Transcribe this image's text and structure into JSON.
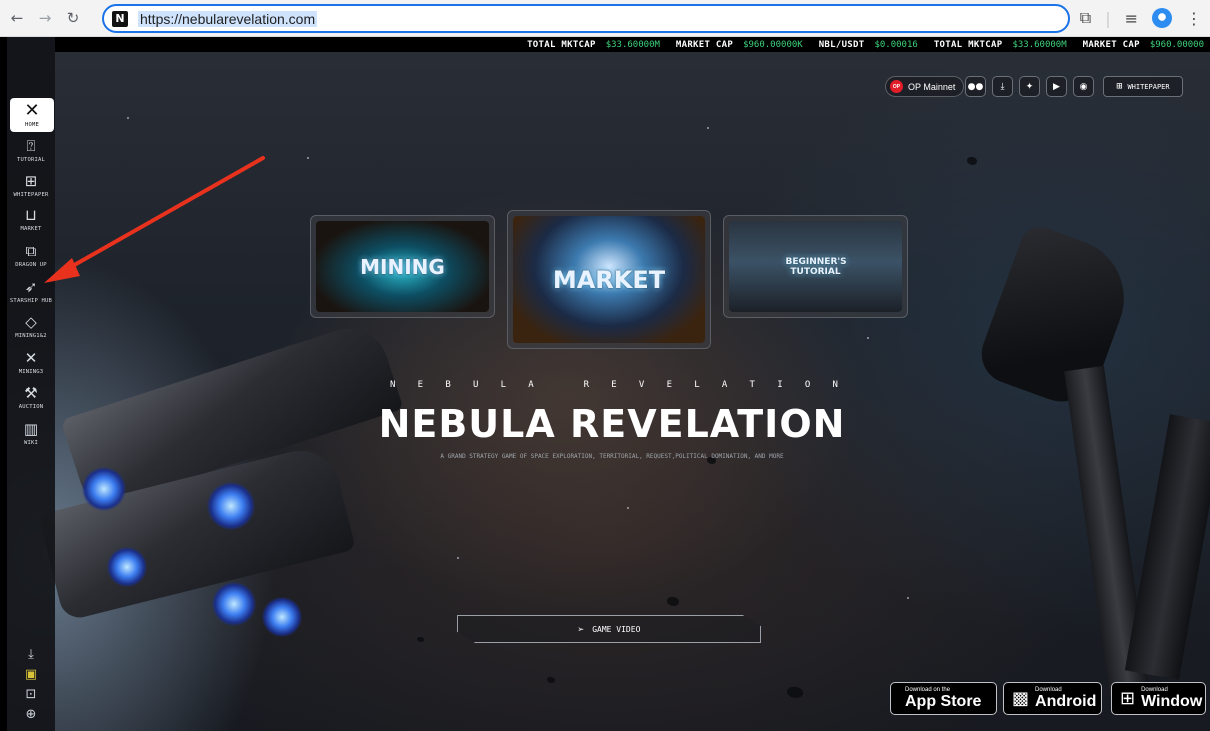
{
  "browser": {
    "url": "https://nebularevelation.com",
    "favicon": "N"
  },
  "ticker": [
    {
      "label": "TOTAL MKTCAP",
      "value": "$33.60000M"
    },
    {
      "label": "MARKET CAP",
      "value": "$960.00000K"
    },
    {
      "label": "NBL/USDT",
      "value": "$0.00016"
    },
    {
      "label": "TOTAL MKTCAP",
      "value": "$33.60000M"
    },
    {
      "label": "MARKET CAP",
      "value": "$960.00000"
    }
  ],
  "sidebar": {
    "items": [
      {
        "label": "HOME",
        "icon": "nebula-logo-icon"
      },
      {
        "label": "TUTORIAL",
        "icon": "question-icon"
      },
      {
        "label": "WHITEPAPER",
        "icon": "book-icon"
      },
      {
        "label": "MARKET",
        "icon": "shopping-bag-icon"
      },
      {
        "label": "DRAGON UP",
        "icon": "copy-icon"
      },
      {
        "label": "STARSHIP HUB",
        "icon": "rocket-icon"
      },
      {
        "label": "MINING1&2",
        "icon": "diamond-icon"
      },
      {
        "label": "MINING3",
        "icon": "crossed-tools-icon"
      },
      {
        "label": "AUCTION",
        "icon": "gavel-icon"
      },
      {
        "label": "WIKI",
        "icon": "library-icon"
      }
    ],
    "bottom_icons": [
      "download-icon",
      "wallet-icon",
      "profile-card-icon",
      "globe-icon"
    ]
  },
  "header": {
    "network": "OP Mainnet",
    "network_badge": "OP",
    "social_icons": [
      "medium-icon",
      "download-icon",
      "twitter-icon",
      "youtube-icon",
      "discord-icon"
    ],
    "whitepaper_label": "WHITEPAPER"
  },
  "cards": [
    {
      "title": "MINING"
    },
    {
      "title": "MARKET"
    },
    {
      "title": "BEGINNER'S TUTORIAL"
    }
  ],
  "hero": {
    "spaced_letters": [
      "N",
      "E",
      "B",
      "U",
      "L",
      "A",
      "",
      "R",
      "E",
      "V",
      "E",
      "L",
      "A",
      "T",
      "I",
      "O",
      "N"
    ],
    "title": "NEBULA REVELATION",
    "subtitle": "A GRAND STRATEGY GAME OF SPACE EXPLORATION, TERRITORIAL, REQUEST,POLITICAL DOMINATION, AND MORE"
  },
  "video_button": "GAME VIDEO",
  "stores": [
    {
      "small": "Download on the",
      "big": "App Store",
      "icon": "apple-icon"
    },
    {
      "small": "Download",
      "big": "Android",
      "icon": "android-icon"
    },
    {
      "small": "Download",
      "big": "Window",
      "icon": "windows-icon"
    }
  ],
  "colors": {
    "ticker_value": "#3ed27a",
    "annotation_arrow": "#e8321e",
    "url_focus": "#1a73e8"
  }
}
